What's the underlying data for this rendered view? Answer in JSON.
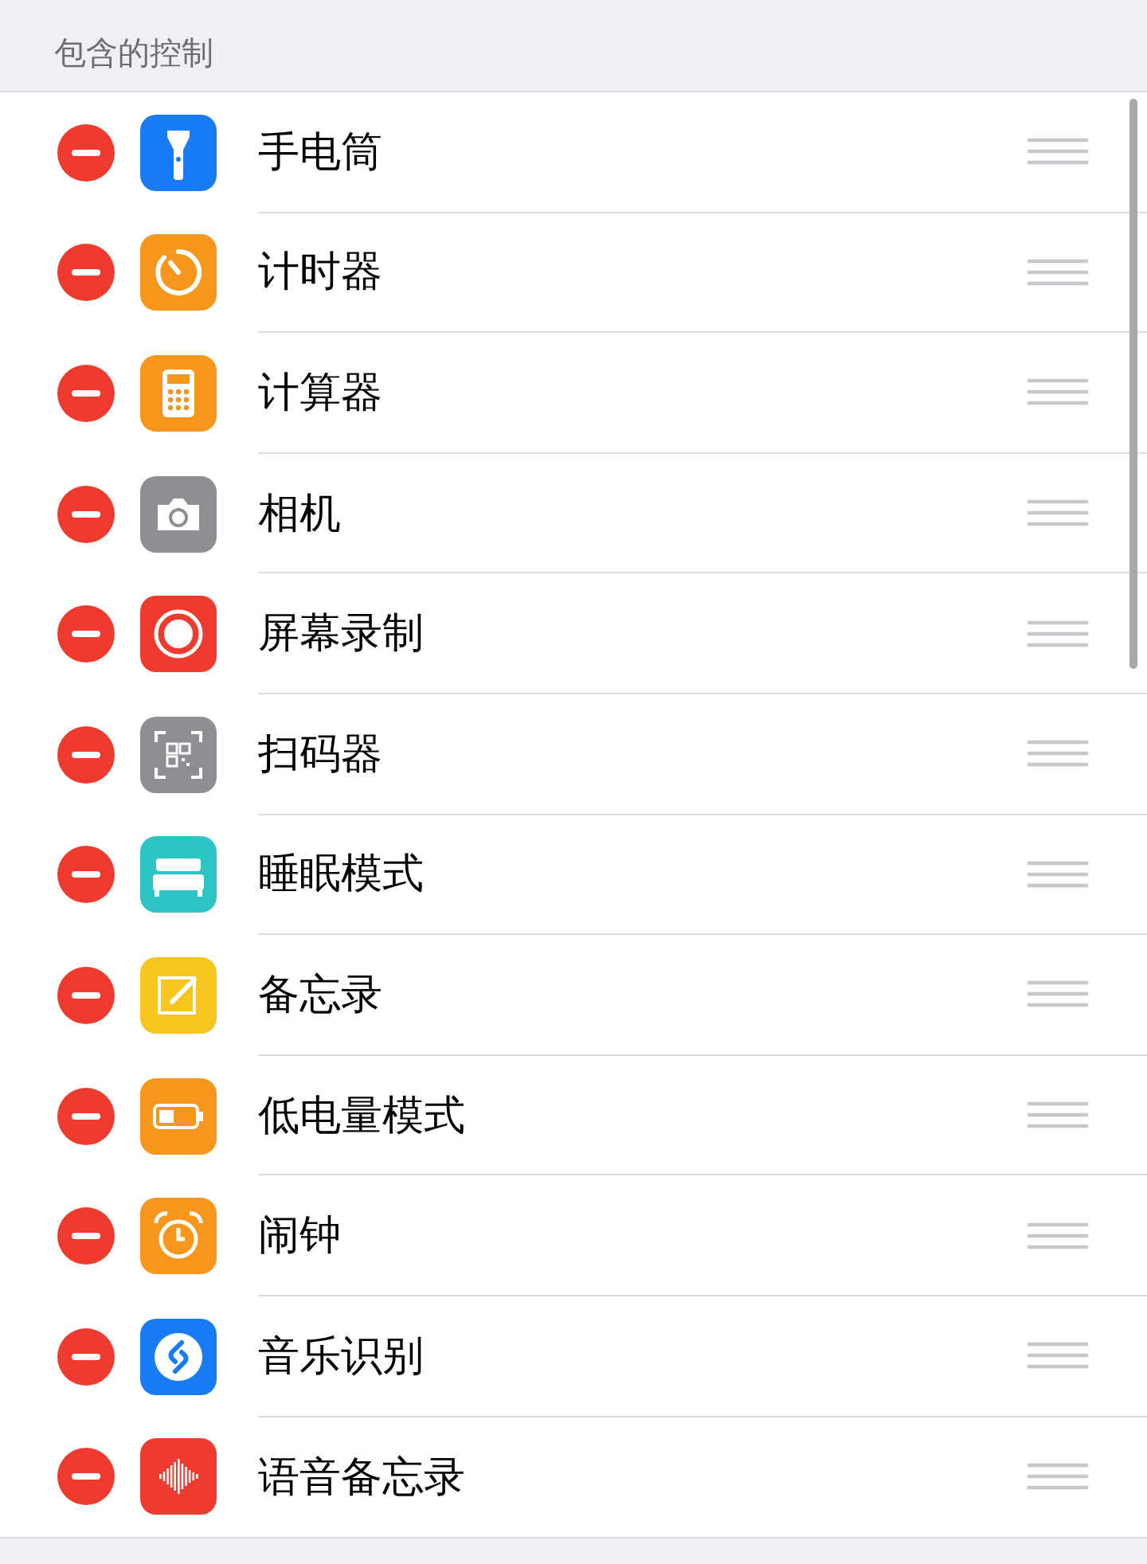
{
  "section_header": "包含的控制",
  "controls": [
    {
      "label": "手电筒",
      "kind": "flashlight"
    },
    {
      "label": "计时器",
      "kind": "timer"
    },
    {
      "label": "计算器",
      "kind": "calculator"
    },
    {
      "label": "相机",
      "kind": "camera"
    },
    {
      "label": "屏幕录制",
      "kind": "record"
    },
    {
      "label": "扫码器",
      "kind": "qr"
    },
    {
      "label": "睡眠模式",
      "kind": "bed"
    },
    {
      "label": "备忘录",
      "kind": "notes"
    },
    {
      "label": "低电量模式",
      "kind": "battery"
    },
    {
      "label": "闹钟",
      "kind": "alarm"
    },
    {
      "label": "音乐识别",
      "kind": "shazam"
    },
    {
      "label": "语音备忘录",
      "kind": "voice"
    }
  ]
}
